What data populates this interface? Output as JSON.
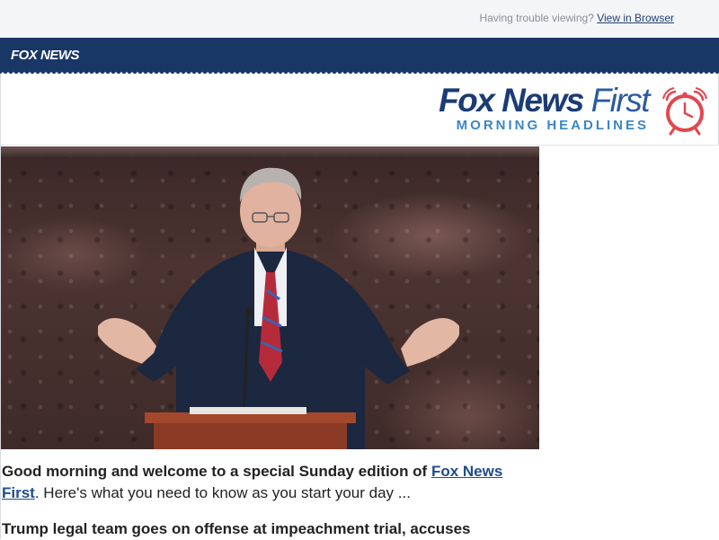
{
  "topbar": {
    "trouble_text": "Having trouble viewing?",
    "view_link": "View in Browser"
  },
  "nav": {
    "logo_text": "FOX NEWS"
  },
  "brand": {
    "title_bold": "Fox News",
    "title_light": "First",
    "subtitle": "MORNING HEADLINES",
    "icon": "alarm-clock-icon"
  },
  "hero": {
    "alt": "speaker-at-podium-photo"
  },
  "intro": {
    "greeting": "Good morning and welcome to a special Sunday edition of ",
    "link": "Fox News First",
    "rest": ". Here's what you need to know as you start your day ..."
  },
  "story": {
    "headline": "Trump legal team goes on offense at impeachment trial, accuses"
  },
  "colors": {
    "navy": "#183666",
    "accent_blue": "#3b86c6",
    "clock_red": "#e2474f"
  }
}
